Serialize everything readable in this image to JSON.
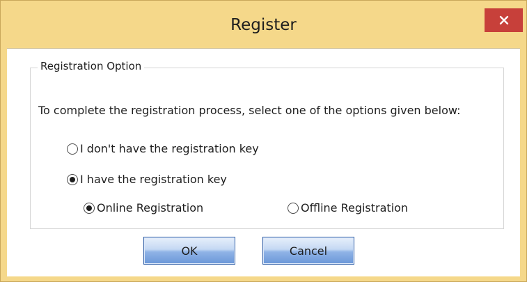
{
  "window": {
    "title": "Register"
  },
  "group": {
    "legend": "Registration Option",
    "instruction": "To complete the registration process, select one of the options given below:",
    "options": [
      {
        "label": "I don't have the registration key",
        "checked": false
      },
      {
        "label": "I have the registration key",
        "checked": true
      }
    ],
    "sub_options": [
      {
        "label": "Online Registration",
        "checked": true
      },
      {
        "label": "Offline Registration",
        "checked": false
      }
    ]
  },
  "buttons": {
    "ok": "OK",
    "cancel": "Cancel"
  },
  "icons": {
    "close": "close-icon"
  },
  "colors": {
    "title_bar": "#f5d88a",
    "close_button": "#c7403a",
    "button_blue": "#6b97d8"
  }
}
